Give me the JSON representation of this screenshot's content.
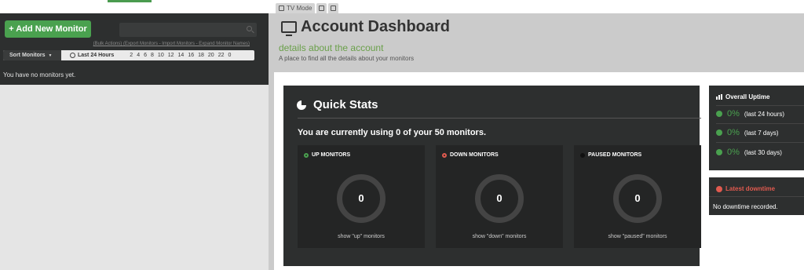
{
  "top": {
    "tv_mode_label": "TV Mode"
  },
  "left": {
    "add_monitor_label": "+ Add New Monitor",
    "search_placeholder": "",
    "bulk_links": "(Bulk Actions) (Export Monitors - Import Monitors - Expand Monitor Names)",
    "sort_label": "Sort Monitors",
    "period_label": "Last 24 Hours",
    "hours": [
      "2",
      "4",
      "6",
      "8",
      "10",
      "12",
      "14",
      "16",
      "18",
      "20",
      "22",
      "0"
    ],
    "empty_message": "You have no monitors yet."
  },
  "header": {
    "title": "Account Dashboard",
    "subtitle": "details about the account",
    "tagline": "A place to find all the details about your monitors"
  },
  "quick_stats": {
    "title": "Quick Stats",
    "usage": "You are currently using 0 of your 50 monitors.",
    "cards": [
      {
        "label": "UP MONITORS",
        "value": "0",
        "link": "show \"up\" monitors",
        "color": "#4aa14f"
      },
      {
        "label": "DOWN MONITORS",
        "value": "0",
        "link": "show \"down\" monitors",
        "color": "#e05a4f"
      },
      {
        "label": "PAUSED MONITORS",
        "value": "0",
        "link": "show \"paused\" monitors",
        "color": "#111111"
      }
    ]
  },
  "uptime": {
    "title": "Overall Uptime",
    "rows": [
      {
        "pct": "0%",
        "period": "(last 24 hours)"
      },
      {
        "pct": "0%",
        "period": "(last 7 days)"
      },
      {
        "pct": "0%",
        "period": "(last 30 days)"
      }
    ]
  },
  "downtime": {
    "title": "Latest downtime",
    "message": "No downtime recorded."
  }
}
